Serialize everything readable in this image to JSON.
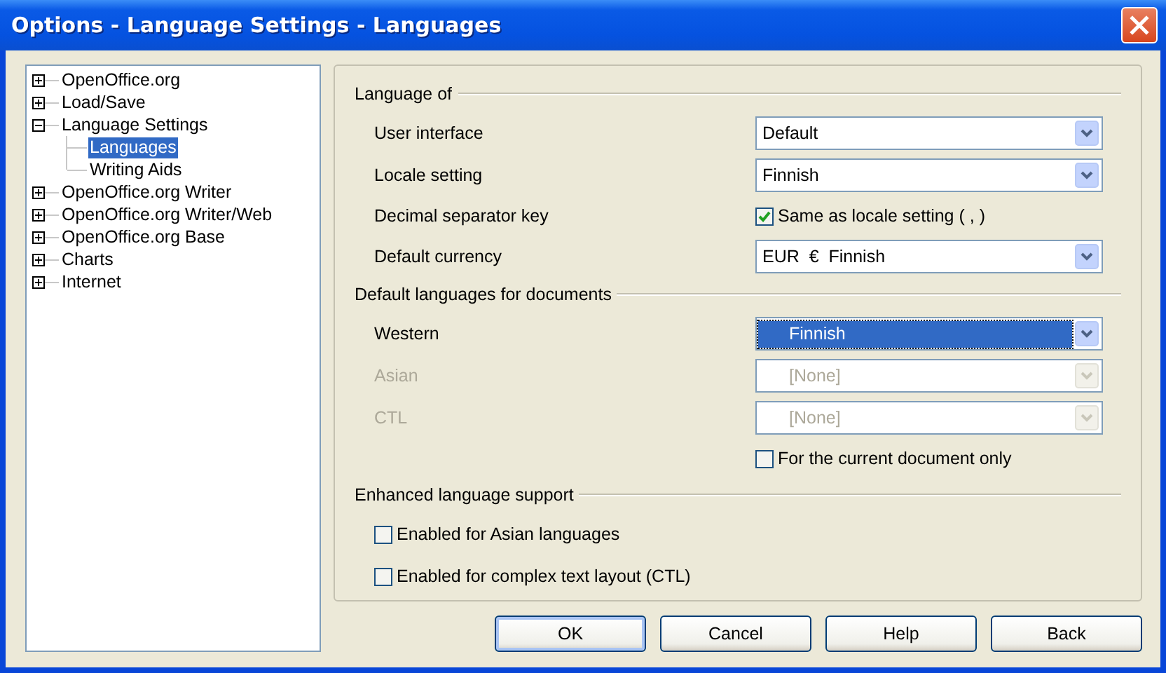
{
  "window": {
    "title": "Options - Language Settings - Languages"
  },
  "tree": [
    {
      "label": "OpenOffice.org",
      "expanded": false,
      "selected": false
    },
    {
      "label": "Load/Save",
      "expanded": false,
      "selected": false
    },
    {
      "label": "Language Settings",
      "expanded": true,
      "selected": false,
      "children": [
        {
          "label": "Languages",
          "selected": true
        },
        {
          "label": "Writing Aids",
          "selected": false
        }
      ]
    },
    {
      "label": "OpenOffice.org Writer",
      "expanded": false,
      "selected": false
    },
    {
      "label": "OpenOffice.org Writer/Web",
      "expanded": false,
      "selected": false
    },
    {
      "label": "OpenOffice.org Base",
      "expanded": false,
      "selected": false
    },
    {
      "label": "Charts",
      "expanded": false,
      "selected": false
    },
    {
      "label": "Internet",
      "expanded": false,
      "selected": false
    }
  ],
  "sections": [
    {
      "title": "Language of",
      "rows": [
        {
          "kind": "dropdown",
          "label": "User interface",
          "value": "Default",
          "disabled": false,
          "selected": false
        },
        {
          "kind": "dropdown",
          "label": "Locale setting",
          "value": "Finnish",
          "disabled": false,
          "selected": false
        },
        {
          "kind": "checkbox",
          "label": "Decimal separator key",
          "text": "Same as locale setting ( , )",
          "checked": true
        },
        {
          "kind": "dropdown",
          "label": "Default currency",
          "value": "EUR  €  Finnish",
          "disabled": false,
          "selected": false
        }
      ]
    },
    {
      "title": "Default languages for documents",
      "rows": [
        {
          "kind": "language-dropdown",
          "label": "Western",
          "value": "Finnish",
          "disabled": false,
          "selected": true
        },
        {
          "kind": "language-dropdown",
          "label": "Asian",
          "value": "[None]",
          "disabled": true,
          "selected": false
        },
        {
          "kind": "language-dropdown",
          "label": "CTL",
          "value": "[None]",
          "disabled": true,
          "selected": false
        },
        {
          "kind": "checkbox",
          "text": "For the current document only",
          "checked": false
        }
      ]
    },
    {
      "title": "Enhanced language support",
      "rows": [
        {
          "kind": "option",
          "text": "Enabled for Asian languages",
          "checked": false
        },
        {
          "kind": "option",
          "text": "Enabled for complex text layout (CTL)",
          "checked": false
        }
      ]
    }
  ],
  "buttons": [
    {
      "label": "OK",
      "default": true
    },
    {
      "label": "Cancel",
      "default": false
    },
    {
      "label": "Help",
      "default": false
    },
    {
      "label": "Back",
      "default": false
    }
  ]
}
